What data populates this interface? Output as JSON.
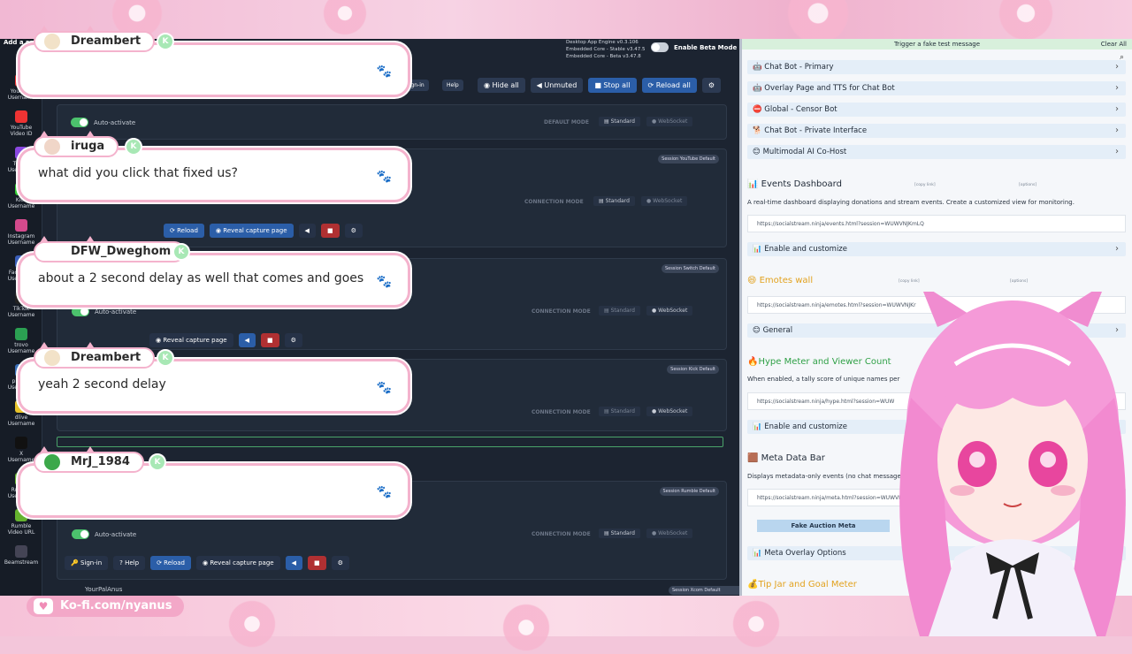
{
  "app": {
    "add_label": "Add a\nsou",
    "version_lines": [
      "Desktop App Engine   v0.3.106",
      "Embedded Core - Stable  v3.47.5",
      "Embedded Core - Beta   v3.47.8"
    ],
    "beta_label": "Enable Beta Mode",
    "top_buttons": {
      "signin": "Sign-in",
      "help": "Help",
      "hide_all": "Hide all",
      "unmuted": "Unmuted",
      "stop_all": "Stop all",
      "reload_all": "Reload all"
    },
    "sidebar": [
      {
        "label": "YouTube\nUsername",
        "color": "#e33"
      },
      {
        "label": "YouTube\nVideo ID",
        "color": "#e33"
      },
      {
        "label": "Twitch\nUsername",
        "color": "#8a48e0"
      },
      {
        "label": "Kick\nUsername",
        "color": "#3c3"
      },
      {
        "label": "Instagram\nUsername",
        "color": "#d34a8c"
      },
      {
        "label": "Facebook\nUsername",
        "color": "#3a5eb8"
      },
      {
        "label": "TikTok\nUsername",
        "color": "#222"
      },
      {
        "label": "trovo\nUsername",
        "color": "#2ba052"
      },
      {
        "label": "picarto\nUsername",
        "color": "#3a6fb8"
      },
      {
        "label": "dlive\nUsername",
        "color": "#e8c32a"
      },
      {
        "label": "X\nUsername",
        "color": "#111"
      },
      {
        "label": "Rumble\nUsername",
        "color": "#65b32e"
      },
      {
        "label": "Rumble\nVideo URL",
        "color": "#65b32e"
      },
      {
        "label": "Beamstream",
        "color": "#445"
      }
    ],
    "panels": [
      {
        "tag": "Session YouTube Default",
        "mode_label": "CONNECTION MODE",
        "mode_a": "Standard",
        "mode_b": "WebSocket"
      },
      {
        "tag": "Session Switch Default",
        "mode_label": "CONNECTION MODE",
        "mode_a": "Standard",
        "mode_b": "WebSocket"
      },
      {
        "tag": "Session Kick Default",
        "mode_label": "CONNECTION MODE",
        "mode_a": "Standard",
        "mode_b": "WebSocket"
      },
      {
        "tag": "Session Rumble Default",
        "mode_label": "CONNECTION MODE",
        "mode_a": "Standard",
        "mode_b": "WebSocket"
      }
    ],
    "default_mode_label": "DEFAULT MODE",
    "auto_activate": "Auto-activate",
    "reload": "Reload",
    "reveal": "Reveal capture page",
    "signin_small": "Sign-in",
    "help_small": "Help",
    "last_user": "YourPalAnus",
    "last_tag": "Session Xcom Default"
  },
  "right": {
    "header": "Trigger a fake test message",
    "clear_all": "Clear All",
    "items": [
      "Chat Bot - Primary",
      "Overlay Page and TTS for Chat Bot",
      "Global - Censor Bot",
      "Chat Bot - Private Interface",
      "Multimodal AI Co-Host"
    ],
    "events_title": "Events Dashboard",
    "events_desc": "A real-time dashboard displaying donations and stream events. Create a customized view for monitoring.",
    "events_url": "https://socialstream.ninja/events.html?session=WUWVNJKmLQ",
    "enable_customize": "Enable and customize",
    "emotes_title": "Emotes wall",
    "emotes_url": "https://socialstream.ninja/emotes.html?session=WUWVNJKr",
    "general": "General",
    "hype_title": "Hype Meter and Viewer Count",
    "hype_desc": "When enabled, a tally score of unique names per",
    "hype_url": "https://socialstream.ninja/hype.html?session=WUW",
    "meta_title": "Meta Data Bar",
    "meta_desc": "Displays metadata-only events (no chat message",
    "meta_url": "https://socialstream.ninja/meta.html?session=WUWVI",
    "fake_auction": "Fake Auction Meta",
    "meta_overlay": "Meta Overlay Options",
    "tip_title": "Tip Jar and Goal Meter",
    "copy_link": "[copy link]",
    "options": "[options]"
  },
  "chat": [
    {
      "name": "Dreambert",
      "text": "",
      "avatar_color": "#f2e2c8"
    },
    {
      "name": "iruga",
      "text": "what did you click that fixed us?",
      "avatar_color": "#f0d6c8"
    },
    {
      "name": "DFW_Dweghom",
      "text": "about a 2 second delay as well that comes and goes",
      "avatar_color": ""
    },
    {
      "name": "Dreambert",
      "text": "yeah 2 second delay",
      "avatar_color": "#f2e2c8"
    },
    {
      "name": "MrJ_1984",
      "text": "",
      "avatar_color": "#3ca84a"
    }
  ],
  "kofi": "Ko-fi.com/nyanus",
  "colors": {
    "accent_pink": "#f4b3cd",
    "app_bg": "#1c2431",
    "panel_bg": "#212b39",
    "btn_blue": "#2b5ea8",
    "btn_red": "#b03032",
    "green": "#4cc26d"
  }
}
